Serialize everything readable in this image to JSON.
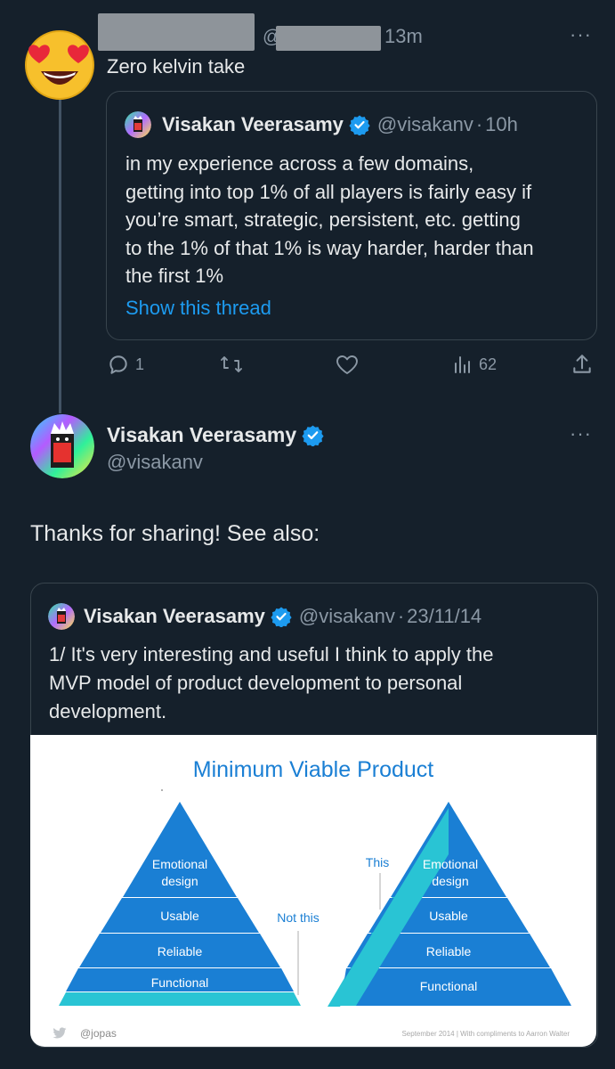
{
  "reply": {
    "handle_prefix": "@",
    "time": "13m",
    "text": "Zero kelvin take",
    "more": "···"
  },
  "quoted_first": {
    "name": "Visakan Veerasamy",
    "handle": "@visakanv",
    "sep": "·",
    "time": "10h",
    "lines": [
      "in my experience across a few domains,",
      "getting into top 1% of all players is fairly easy if",
      "you’re smart, strategic, persistent, etc. getting",
      "to the 1% of that 1% is way harder, harder than",
      "the first 1%"
    ],
    "show_thread": "Show this thread"
  },
  "actions": {
    "replies": "1",
    "retweets": "",
    "likes": "",
    "views": "62"
  },
  "main_tweet": {
    "name": "Visakan Veerasamy",
    "handle": "@visakanv",
    "more": "···",
    "text": "Thanks for sharing! See also:"
  },
  "quoted_second": {
    "name": "Visakan Veerasamy",
    "handle": "@visakanv",
    "sep": "·",
    "date": "23/11/14",
    "lines": [
      "1/ It's very interesting and useful I think to apply the",
      "MVP model of product development to personal",
      "development."
    ]
  },
  "image": {
    "title": "Minimum Viable Product",
    "left_pyramid": [
      "Emotional",
      "design",
      "Usable",
      "Reliable",
      "Functional"
    ],
    "right_pyramid": [
      "Emotional",
      "design",
      "Usable",
      "Reliable",
      "Functional"
    ],
    "not_this": "Not this",
    "this": "This",
    "credit": "@jopas",
    "footer": "September 2014 | With compliments to Aarron Walter"
  },
  "colors": {
    "background": "#15202b",
    "text": "#e7e9ea",
    "muted": "#8b98a5",
    "accent": "#1d9bf0",
    "pyramid_blue": "#1a7fd4",
    "pyramid_teal": "#29c4d4"
  }
}
